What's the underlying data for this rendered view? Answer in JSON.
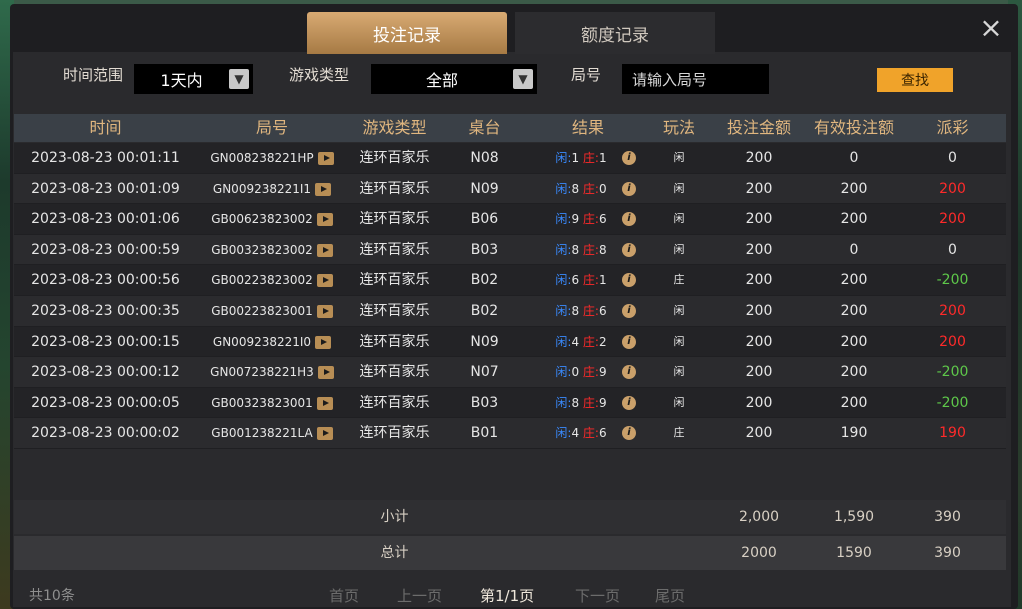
{
  "tabs": {
    "bet_records": "投注记录",
    "credit_records": "额度记录"
  },
  "close_label": "×",
  "filters": {
    "time_label": "时间范围",
    "time_value": "1天内",
    "game_type_label": "游戏类型",
    "game_type_value": "全部",
    "round_label": "局号",
    "round_placeholder": "请输入局号",
    "search_label": "查找"
  },
  "columns": [
    "时间",
    "局号",
    "游戏类型",
    "桌台",
    "结果",
    "玩法",
    "投注金额",
    "有效投注额",
    "派彩"
  ],
  "rows": [
    {
      "time": "2023-08-23 00:01:11",
      "round": "GN008238221HP",
      "game": "连环百家乐",
      "table": "N08",
      "player_label": "闲",
      "player_score": "1",
      "banker_label": "庄",
      "banker_score": "1",
      "play": "闲",
      "bet": "200",
      "valid": "0",
      "payout": "0",
      "payout_color": "white"
    },
    {
      "time": "2023-08-23 00:01:09",
      "round": "GN009238221I1",
      "game": "连环百家乐",
      "table": "N09",
      "player_label": "闲",
      "player_score": "8",
      "banker_label": "庄",
      "banker_score": "0",
      "play": "闲",
      "bet": "200",
      "valid": "200",
      "payout": "200",
      "payout_color": "red"
    },
    {
      "time": "2023-08-23 00:01:06",
      "round": "GB00623823002",
      "game": "连环百家乐",
      "table": "B06",
      "player_label": "闲",
      "player_score": "9",
      "banker_label": "庄",
      "banker_score": "6",
      "play": "闲",
      "bet": "200",
      "valid": "200",
      "payout": "200",
      "payout_color": "red"
    },
    {
      "time": "2023-08-23 00:00:59",
      "round": "GB00323823002",
      "game": "连环百家乐",
      "table": "B03",
      "player_label": "闲",
      "player_score": "8",
      "banker_label": "庄",
      "banker_score": "8",
      "play": "闲",
      "bet": "200",
      "valid": "0",
      "payout": "0",
      "payout_color": "white"
    },
    {
      "time": "2023-08-23 00:00:56",
      "round": "GB00223823002",
      "game": "连环百家乐",
      "table": "B02",
      "player_label": "闲",
      "player_score": "6",
      "banker_label": "庄",
      "banker_score": "1",
      "play": "庄",
      "bet": "200",
      "valid": "200",
      "payout": "-200",
      "payout_color": "green"
    },
    {
      "time": "2023-08-23 00:00:35",
      "round": "GB00223823001",
      "game": "连环百家乐",
      "table": "B02",
      "player_label": "闲",
      "player_score": "8",
      "banker_label": "庄",
      "banker_score": "6",
      "play": "闲",
      "bet": "200",
      "valid": "200",
      "payout": "200",
      "payout_color": "red"
    },
    {
      "time": "2023-08-23 00:00:15",
      "round": "GN009238221I0",
      "game": "连环百家乐",
      "table": "N09",
      "player_label": "闲",
      "player_score": "4",
      "banker_label": "庄",
      "banker_score": "2",
      "play": "闲",
      "bet": "200",
      "valid": "200",
      "payout": "200",
      "payout_color": "red"
    },
    {
      "time": "2023-08-23 00:00:12",
      "round": "GN007238221H3",
      "game": "连环百家乐",
      "table": "N07",
      "player_label": "闲",
      "player_score": "0",
      "banker_label": "庄",
      "banker_score": "9",
      "play": "闲",
      "bet": "200",
      "valid": "200",
      "payout": "-200",
      "payout_color": "green"
    },
    {
      "time": "2023-08-23 00:00:05",
      "round": "GB00323823001",
      "game": "连环百家乐",
      "table": "B03",
      "player_label": "闲",
      "player_score": "8",
      "banker_label": "庄",
      "banker_score": "9",
      "play": "闲",
      "bet": "200",
      "valid": "200",
      "payout": "-200",
      "payout_color": "green"
    },
    {
      "time": "2023-08-23 00:00:02",
      "round": "GB001238221LA",
      "game": "连环百家乐",
      "table": "B01",
      "player_label": "闲",
      "player_score": "4",
      "banker_label": "庄",
      "banker_score": "6",
      "play": "庄",
      "bet": "200",
      "valid": "190",
      "payout": "190",
      "payout_color": "red"
    }
  ],
  "subtotal": {
    "label": "小计",
    "bet": "2,000",
    "valid": "1,590",
    "payout": "390"
  },
  "total": {
    "label": "总计",
    "bet": "2000",
    "valid": "1590",
    "payout": "390"
  },
  "footer": {
    "count": "共10条",
    "first": "首页",
    "prev": "上一页",
    "current": "第1/1页",
    "next": "下一页",
    "last": "尾页"
  },
  "colors": {
    "accent": "#e0b67f",
    "search_button": "#f0a32a",
    "win": "#ff2a2a",
    "loss": "#5ec84a",
    "player": "#3a8bff"
  }
}
